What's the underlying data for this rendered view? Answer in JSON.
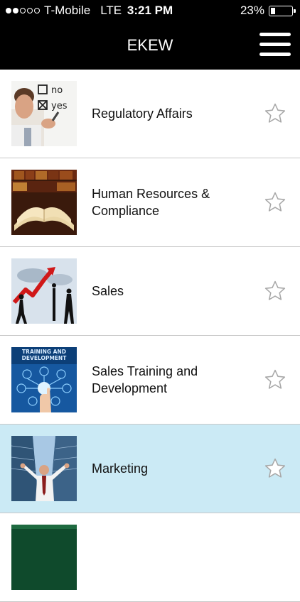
{
  "status_bar": {
    "signal_full": 2,
    "signal_total": 5,
    "carrier": "T-Mobile",
    "network": "LTE",
    "time": "3:21 PM",
    "battery_text": "23%",
    "battery_level": 0.23
  },
  "nav": {
    "title": "EKEW",
    "menu_icon": "hamburger-menu-icon"
  },
  "colors": {
    "nav_background": "#000000",
    "selected_row": "#cbeaf5",
    "divider": "#c8c8c8"
  },
  "thumbnail_text": {
    "regulatory_no": "no",
    "regulatory_yes": "yes",
    "training_line1": "TRAINING AND",
    "training_line2": "DEVELOPMENT"
  },
  "rows": [
    {
      "label": "Regulatory Affairs",
      "selected": false,
      "favorite": false
    },
    {
      "label": "Human Resources & Compliance",
      "selected": false,
      "favorite": false
    },
    {
      "label": "Sales",
      "selected": false,
      "favorite": false
    },
    {
      "label": "Sales Training and Development",
      "selected": false,
      "favorite": false
    },
    {
      "label": "Marketing",
      "selected": true,
      "favorite": false
    },
    {
      "label": "",
      "selected": false,
      "favorite": false
    }
  ]
}
